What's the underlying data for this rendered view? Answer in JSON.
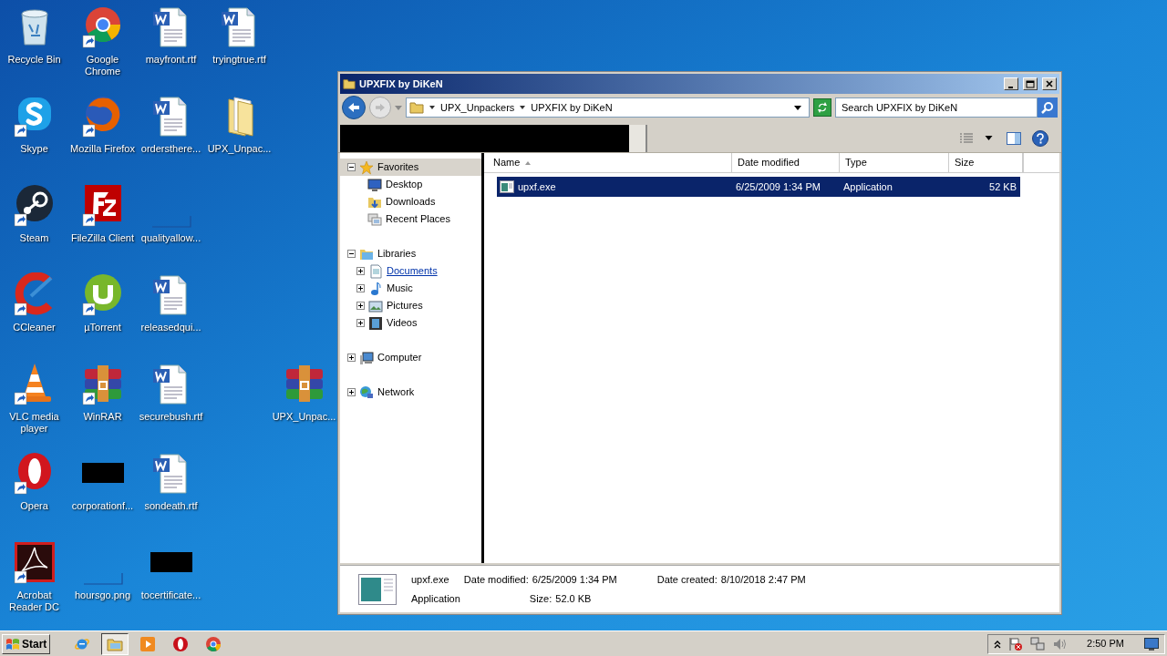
{
  "desktop": {
    "columns": [
      [
        {
          "label": "Recycle Bin",
          "kind": "recycle",
          "shortcut": false
        },
        {
          "label": "Skype",
          "kind": "skype",
          "shortcut": true
        },
        {
          "label": "Steam",
          "kind": "steam",
          "shortcut": true
        },
        {
          "label": "CCleaner",
          "kind": "ccleaner",
          "shortcut": true
        },
        {
          "label": "VLC media player",
          "kind": "vlc",
          "shortcut": true
        },
        {
          "label": "Opera",
          "kind": "opera",
          "shortcut": true
        },
        {
          "label": "Acrobat Reader DC",
          "kind": "acrobat",
          "shortcut": true
        }
      ],
      [
        {
          "label": "Google Chrome",
          "kind": "chrome",
          "shortcut": true
        },
        {
          "label": "Mozilla Firefox",
          "kind": "firefox",
          "shortcut": true
        },
        {
          "label": "FileZilla Client",
          "kind": "filezilla",
          "shortcut": true
        },
        {
          "label": "µTorrent",
          "kind": "utorrent",
          "shortcut": true
        },
        {
          "label": "WinRAR",
          "kind": "winrar",
          "shortcut": true
        },
        {
          "label": "corporationf...",
          "kind": "redacted",
          "shortcut": false
        },
        {
          "label": "hoursgo.png",
          "kind": "blank",
          "shortcut": false
        }
      ],
      [
        {
          "label": "mayfront.rtf",
          "kind": "doc",
          "shortcut": false
        },
        {
          "label": "ordersthere...",
          "kind": "doc",
          "shortcut": false
        },
        {
          "label": "qualityallow...",
          "kind": "blank",
          "shortcut": false
        },
        {
          "label": "releasedqui...",
          "kind": "doc",
          "shortcut": false
        },
        {
          "label": "securebush.rtf",
          "kind": "doc",
          "shortcut": false
        },
        {
          "label": "sondeath.rtf",
          "kind": "doc",
          "shortcut": false
        },
        {
          "label": "tocertificate...",
          "kind": "redacted",
          "shortcut": false
        }
      ],
      [
        {
          "label": "tryingtrue.rtf",
          "kind": "doc",
          "shortcut": false
        },
        {
          "label": "UPX_Unpac...",
          "kind": "folder",
          "shortcut": false
        }
      ],
      [
        {
          "label": "UPX_Unpac...",
          "kind": "winrar",
          "shortcut": false
        }
      ]
    ]
  },
  "window": {
    "title": "UPXFIX by DiKeN",
    "breadcrumb": [
      "UPX_Unpackers",
      "UPXFIX by DiKeN"
    ],
    "search": {
      "placeholder": "Search UPXFIX by DiKeN"
    },
    "nav": [
      {
        "label": "Favorites",
        "expanded": true,
        "selected": true,
        "hot": false,
        "children": [
          {
            "label": "Desktop",
            "selected": false,
            "hot": false
          },
          {
            "label": "Downloads",
            "selected": false,
            "hot": false
          },
          {
            "label": "Recent Places",
            "selected": false,
            "hot": false
          }
        ]
      },
      {
        "label": "Libraries",
        "expanded": true,
        "selected": false,
        "hot": false,
        "children": [
          {
            "label": "Documents",
            "expanded": false,
            "selected": false,
            "hot": true
          },
          {
            "label": "Music",
            "expanded": false,
            "selected": false,
            "hot": false
          },
          {
            "label": "Pictures",
            "expanded": false,
            "selected": false,
            "hot": false
          },
          {
            "label": "Videos",
            "expanded": false,
            "selected": false,
            "hot": false
          }
        ]
      },
      {
        "label": "Computer",
        "expanded": false,
        "selected": false,
        "hot": false
      },
      {
        "label": "Network",
        "expanded": false,
        "selected": false,
        "hot": false
      }
    ],
    "columns": [
      {
        "label": "Name",
        "sorted": true
      },
      {
        "label": "Date modified",
        "sorted": false
      },
      {
        "label": "Type",
        "sorted": false
      },
      {
        "label": "Size",
        "sorted": false
      }
    ],
    "files": [
      {
        "name": "upxf.exe",
        "date_modified": "6/25/2009 1:34 PM",
        "type": "Application",
        "size": "52 KB",
        "selected": true
      }
    ],
    "details": {
      "name": "upxf.exe",
      "type": "Application",
      "date_modified_label": "Date modified:",
      "date_modified": "6/25/2009 1:34 PM",
      "date_created_label": "Date created:",
      "date_created": "8/10/2018 2:47 PM",
      "size_label": "Size:",
      "size": "52.0 KB"
    }
  },
  "taskbar": {
    "start": "Start",
    "apps": [
      {
        "kind": "ie",
        "active": false
      },
      {
        "kind": "explorer",
        "active": true
      },
      {
        "kind": "media",
        "active": false
      },
      {
        "kind": "opera",
        "active": false
      },
      {
        "kind": "chrome",
        "active": false
      }
    ],
    "clock": "2:50 PM"
  }
}
